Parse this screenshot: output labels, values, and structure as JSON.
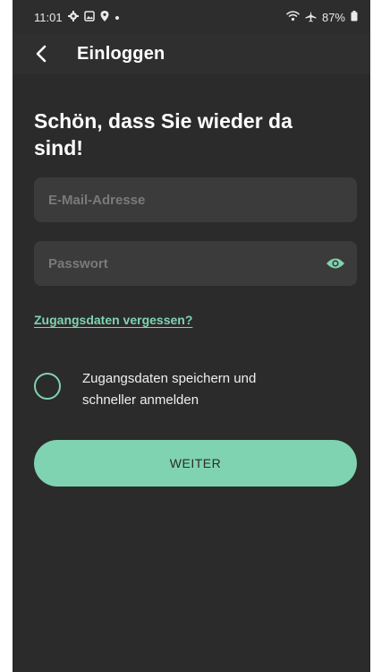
{
  "status_bar": {
    "time": "11:01",
    "icons_left": [
      "gear-icon",
      "image-icon",
      "location-icon",
      "dot-icon"
    ],
    "icons_right": [
      "wifi-icon",
      "airplane-icon",
      "battery-icon"
    ],
    "battery": "87%"
  },
  "app_bar": {
    "title": "Einloggen"
  },
  "login": {
    "headline": "Schön, dass Sie wieder da sind!",
    "email_placeholder": "E-Mail-Adresse",
    "email_value": "",
    "password_placeholder": "Passwort",
    "password_value": "",
    "forgot_link": "Zugangsdaten vergessen?",
    "remember_label": "Zugangsdaten speichern und schneller anmelden",
    "remember_checked": false,
    "submit_label": "WEITER"
  },
  "colors": {
    "background": "#2b2b2b",
    "input_background": "#3b3b3b",
    "accent": "#7fd3b1",
    "text": "#ffffff"
  }
}
